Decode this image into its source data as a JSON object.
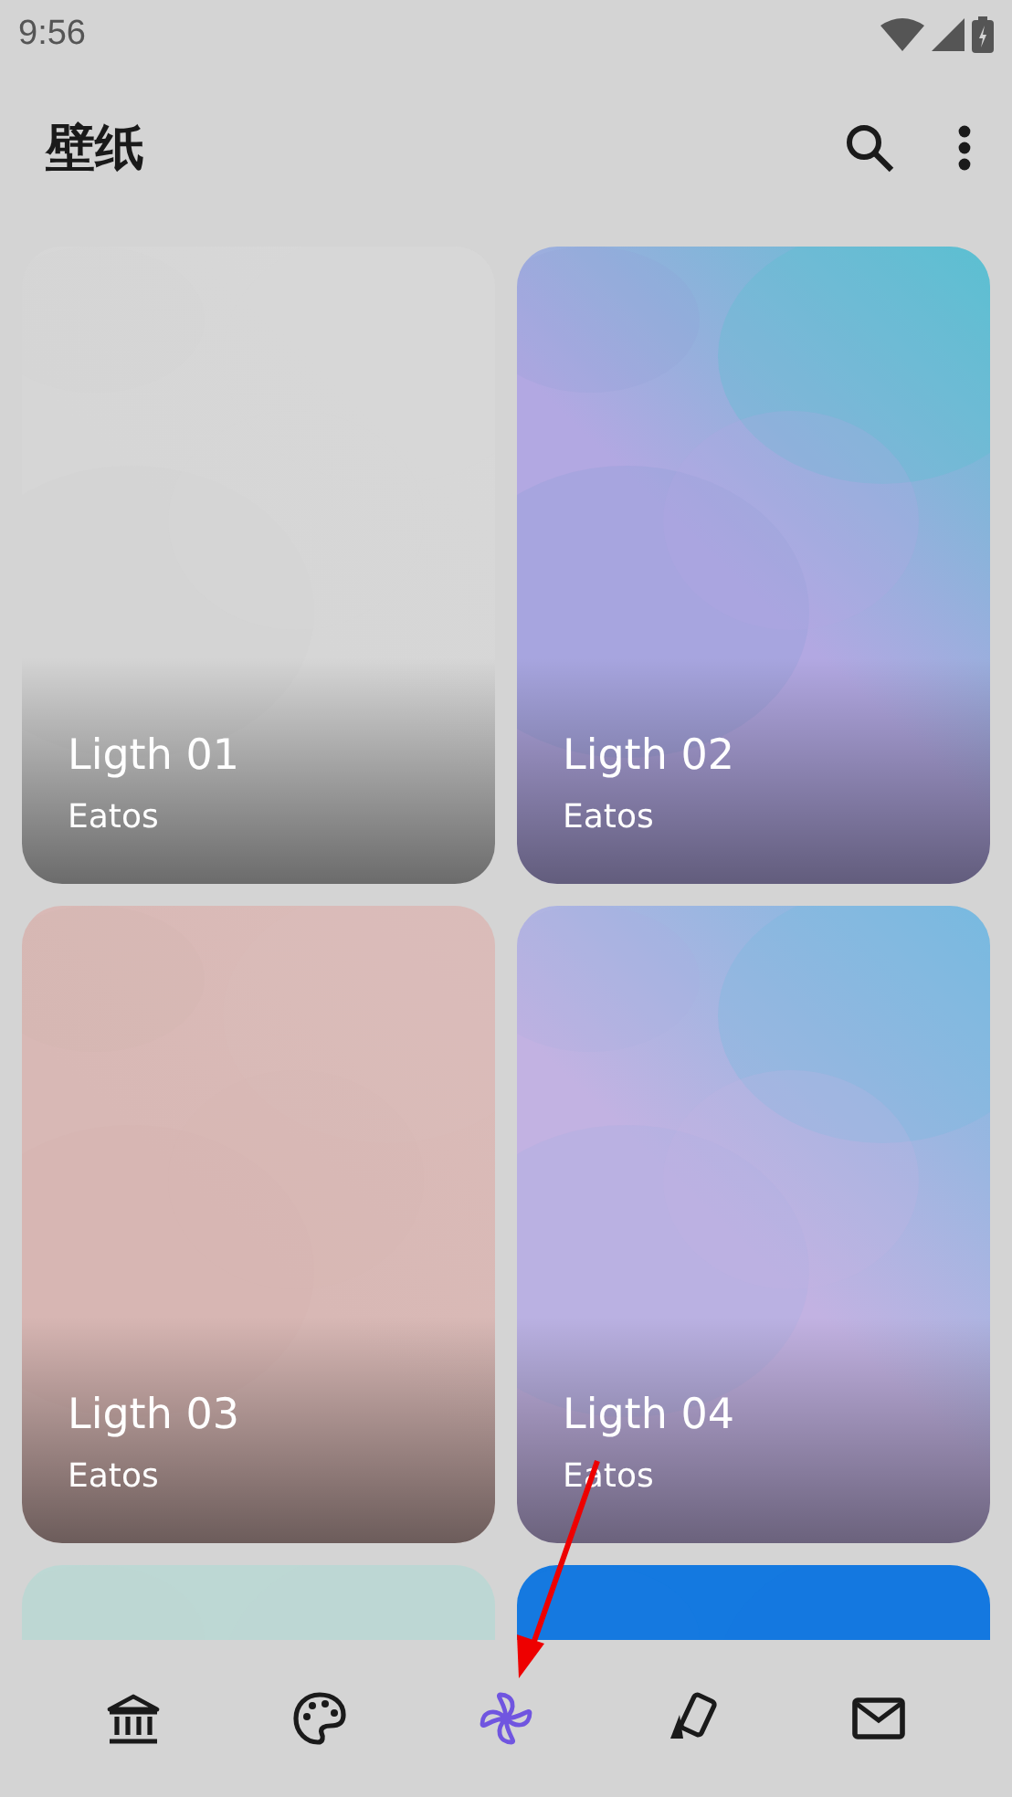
{
  "status_bar": {
    "time": "9:56"
  },
  "app_bar": {
    "title": "壁纸"
  },
  "wallpapers": [
    {
      "kind": "picture",
      "title": "Ligth 01",
      "author": "Eatos"
    },
    {
      "kind": "picture",
      "title": "Ligth 02",
      "author": "Eatos"
    },
    {
      "kind": "picture",
      "title": "Ligth 03",
      "author": "Eatos"
    },
    {
      "kind": "picture",
      "title": "Ligth 04",
      "author": "Eatos"
    },
    {
      "kind": "picture"
    },
    {
      "kind": "picture"
    }
  ],
  "bottom_nav": [
    {
      "selected": false
    },
    {
      "selected": false
    },
    {
      "selected": true
    },
    {
      "selected": false
    },
    {
      "selected": false
    }
  ]
}
